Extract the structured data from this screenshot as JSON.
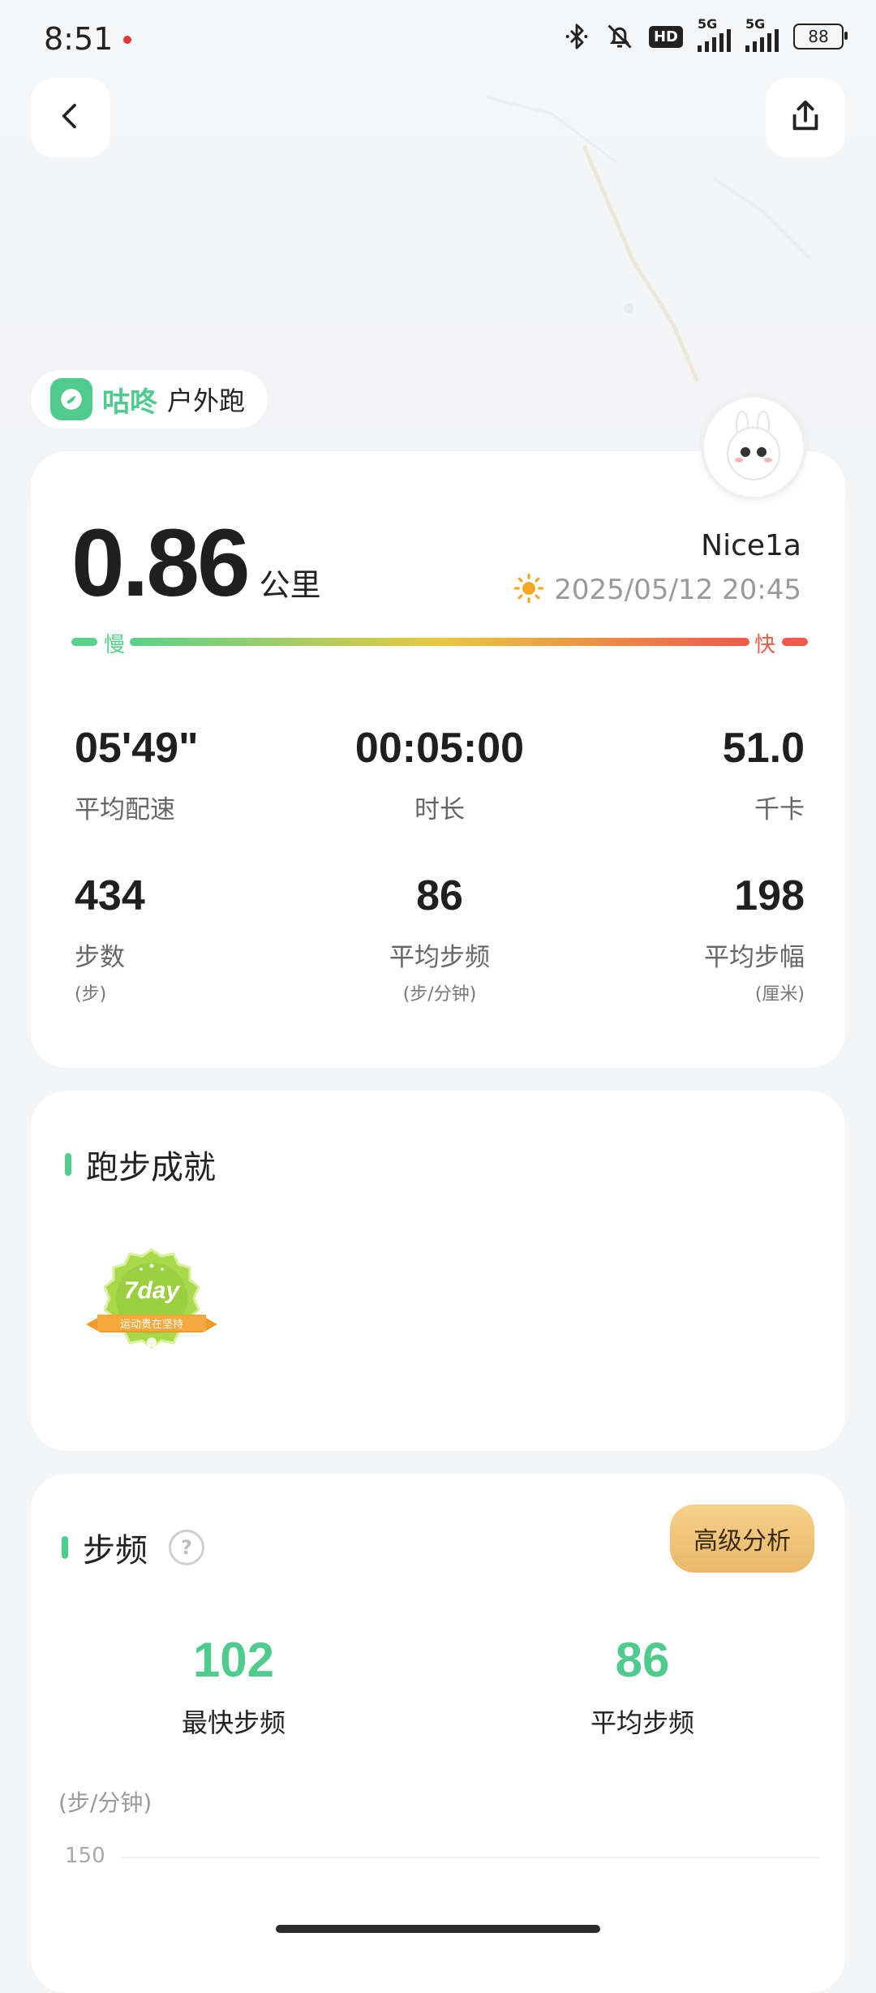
{
  "status_bar": {
    "time": "8:51",
    "hd_label": "HD",
    "signal1_label": "5G",
    "signal2_label": "5G",
    "battery": "88",
    "icons": [
      "bluetooth-icon",
      "bell-off-icon",
      "hd-icon",
      "signal-icon",
      "signal-icon",
      "battery-icon"
    ]
  },
  "header": {
    "back_icon": "chevron-left-icon",
    "share_icon": "share-icon"
  },
  "brand": {
    "name": "咕咚",
    "activity": "户外跑"
  },
  "summary": {
    "distance_value": "0.86",
    "distance_unit": "公里",
    "username": "Nice1a",
    "datetime": "2025/05/12 20:45",
    "pace_slow": "慢",
    "pace_fast": "快",
    "colors": {
      "slow": "#58d28a",
      "mid": "#e9c843",
      "fast": "#ef5a4a"
    },
    "stats": [
      {
        "value": "05'49\"",
        "label": "平均配速"
      },
      {
        "value": "00:05:00",
        "label": "时长"
      },
      {
        "value": "51.0",
        "label": "千卡"
      },
      {
        "value": "434",
        "label": "步数",
        "unit": "(步)"
      },
      {
        "value": "86",
        "label": "平均步频",
        "unit": "(步/分钟)"
      },
      {
        "value": "198",
        "label": "平均步幅",
        "unit": "(厘米)"
      }
    ]
  },
  "achievements": {
    "title": "跑步成就",
    "badge_days": "7day",
    "badge_ribbon": "运动贵在坚持"
  },
  "cadence": {
    "title": "步频",
    "advanced_button": "高级分析",
    "fastest_value": "102",
    "fastest_label": "最快步频",
    "average_value": "86",
    "average_label": "平均步频",
    "axis_unit": "(步/分钟)",
    "axis_tick": "150"
  },
  "accent_color": "#4fcc8d"
}
